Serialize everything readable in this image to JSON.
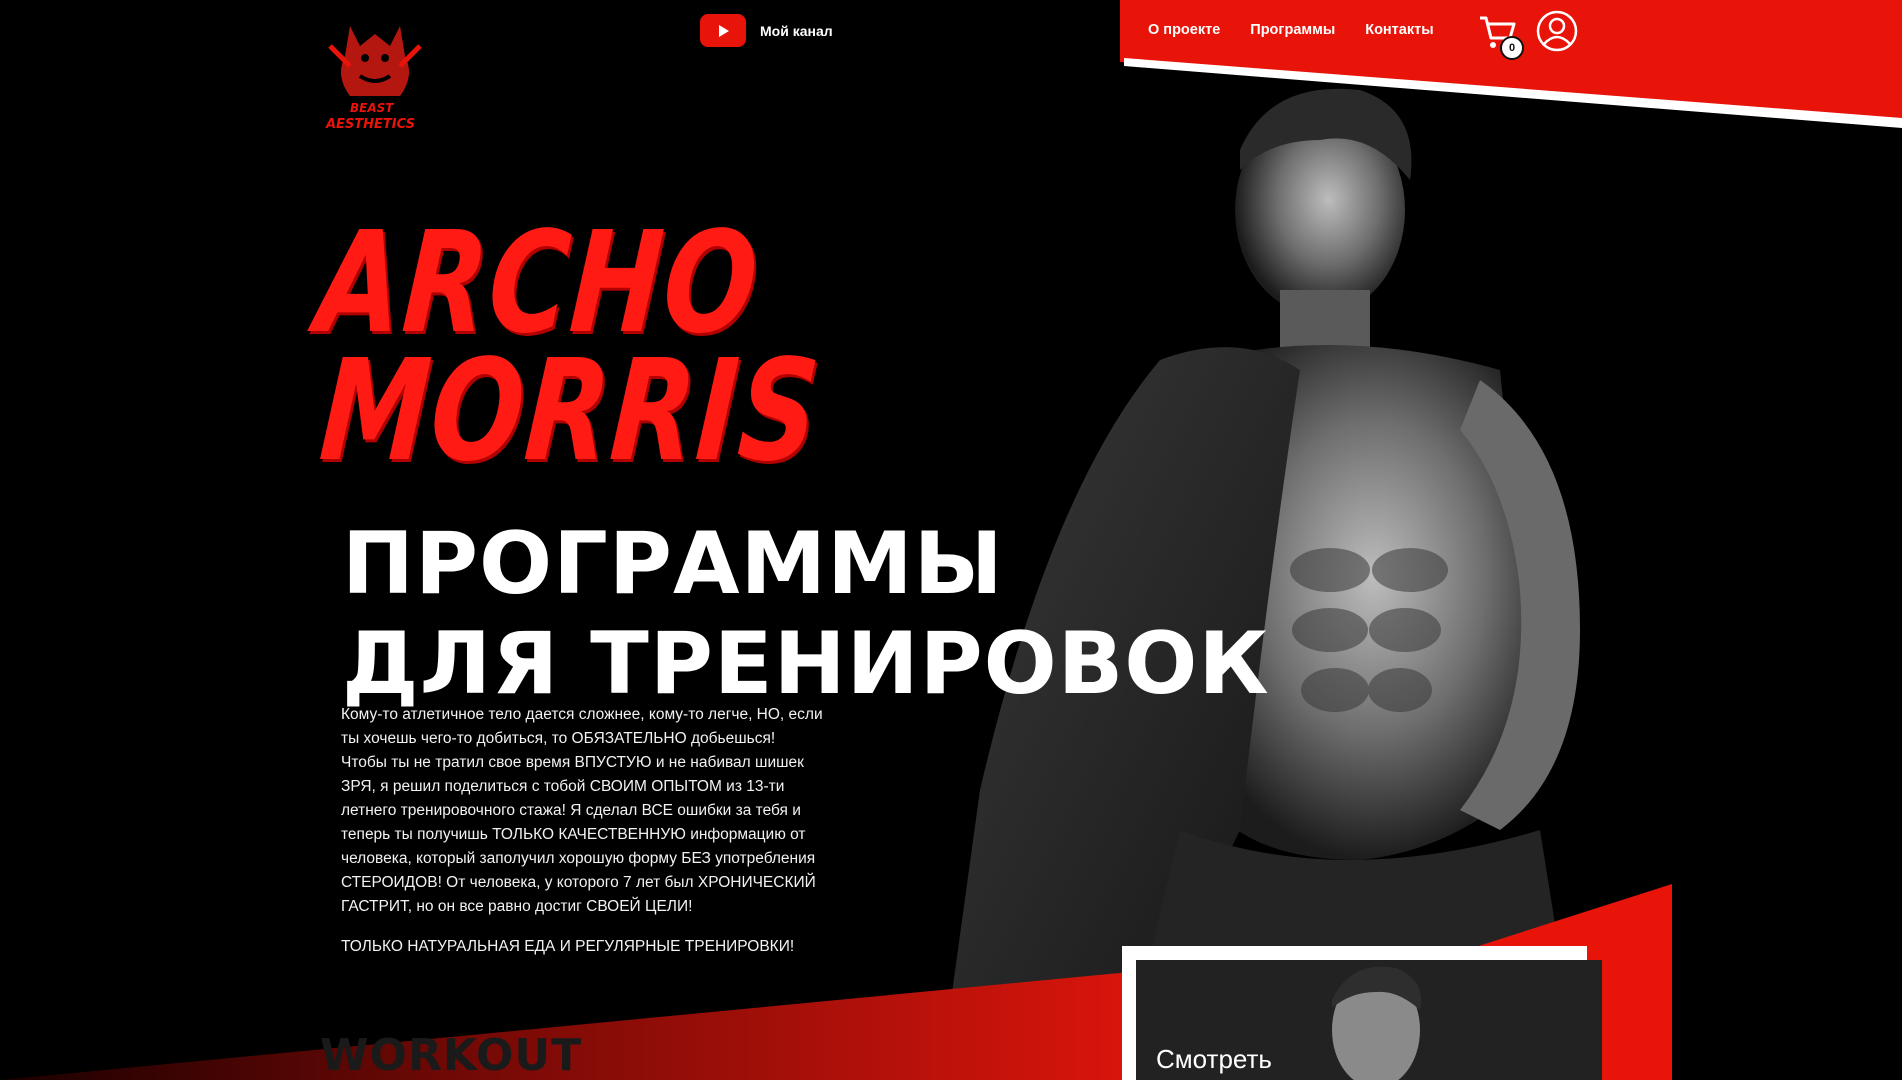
{
  "header": {
    "youtube_label": "Мой канал",
    "nav": [
      "О проекте",
      "Программы",
      "Контакты"
    ],
    "cart_count": "0"
  },
  "hero": {
    "brush_title": [
      "ARCHO",
      "MORRIS"
    ],
    "title": [
      "ПРОГРАММЫ",
      "ДЛЯ ТРЕНИРОВОК"
    ],
    "description": "Кому-то атлетичное тело дается сложнее, кому-то легче, НО, если ты хочешь чего-то добиться, то ОБЯЗАТЕЛЬНО добьешься! Чтобы ты не тратил свое время ВПУСТУЮ и не набивал шишек ЗРЯ, я решил поделиться с тобой СВОИМ ОПЫТОМ из 13-ти летнего тренировочного стажа! Я сделал ВСЕ ошибки за тебя и теперь ты получишь ТОЛЬКО КАЧЕСТВЕННУЮ информацию от человека, который заполучил хорошую форму БЕЗ употребления СТЕРОИДОВ! От человека, у которого 7 лет был ХРОНИЧЕСКИЙ ГАСТРИТ, но он все равно достиг СВОЕЙ ЦЕЛИ!",
    "tagline": "ТОЛЬКО НАТУРАЛЬНАЯ ЕДА И РЕГУЛЯРНЫЕ ТРЕНИРОВКИ!",
    "workout_label": "WORKOUT"
  },
  "video": {
    "label": "Смотреть"
  },
  "logo": {
    "text": [
      "BEAST",
      "AESTHETICS"
    ]
  },
  "colors": {
    "accent": "#e8140a",
    "background": "#000000"
  }
}
